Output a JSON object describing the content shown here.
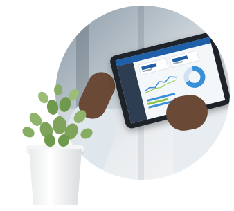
{
  "colors": {
    "background": "#ffffff",
    "tablet_header": "#1f5fa8",
    "chart_donut": "#3a8fd9",
    "plant_green": "#7fa35a",
    "pot_white": "#f4f5f6"
  },
  "icons": [
    "plant-pot",
    "tablet-device"
  ]
}
